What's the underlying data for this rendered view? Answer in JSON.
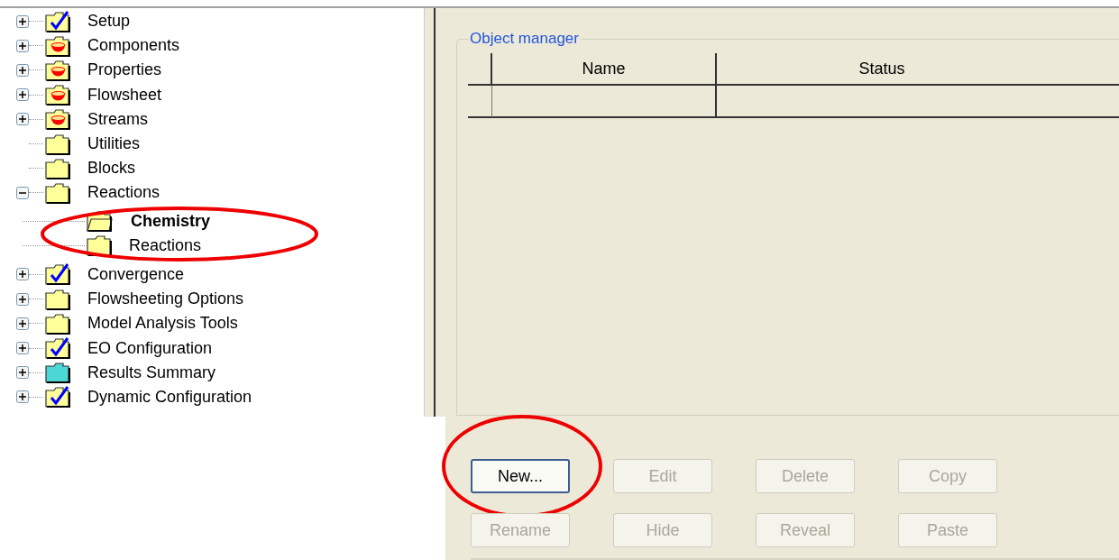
{
  "tree": [
    {
      "label": "Setup",
      "kind": "check",
      "expanded": false,
      "selected": false
    },
    {
      "label": "Components",
      "kind": "pot",
      "expanded": false,
      "selected": false
    },
    {
      "label": "Properties",
      "kind": "pot",
      "expanded": false,
      "selected": false
    },
    {
      "label": "Flowsheet",
      "kind": "pot",
      "expanded": false,
      "selected": false
    },
    {
      "label": "Streams",
      "kind": "pot",
      "expanded": false,
      "selected": false
    },
    {
      "label": "Utilities",
      "kind": "folder",
      "selected": false
    },
    {
      "label": "Blocks",
      "kind": "folder",
      "selected": false
    },
    {
      "label": "Reactions",
      "kind": "folder",
      "expanded": true,
      "selected": false,
      "children_circled": true,
      "children": [
        {
          "label": "Chemistry",
          "kind": "open",
          "selected": true
        },
        {
          "label": "Reactions",
          "kind": "folder",
          "selected": false
        }
      ]
    },
    {
      "label": "Convergence",
      "kind": "check",
      "expanded": false,
      "selected": false
    },
    {
      "label": "Flowsheeting Options",
      "kind": "folder",
      "expanded": false,
      "selected": false
    },
    {
      "label": "Model Analysis Tools",
      "kind": "folder",
      "expanded": false,
      "selected": false
    },
    {
      "label": "EO Configuration",
      "kind": "check",
      "expanded": false,
      "selected": false
    },
    {
      "label": "Results Summary",
      "kind": "cyan",
      "expanded": false,
      "selected": false
    },
    {
      "label": "Dynamic Configuration",
      "kind": "check",
      "expanded": false,
      "selected": false
    }
  ],
  "object_manager": {
    "title": "Object manager",
    "columns": [
      "Name",
      "Status"
    ],
    "buttons": [
      {
        "label": "New...",
        "disabled": false,
        "circled": true
      },
      {
        "label": "Edit",
        "disabled": true,
        "circled": false
      },
      {
        "label": "Delete",
        "disabled": true,
        "circled": false
      },
      {
        "label": "Copy",
        "disabled": true,
        "circled": false
      },
      {
        "label": "Rename",
        "disabled": true,
        "circled": false
      },
      {
        "label": "Hide",
        "disabled": true,
        "circled": false
      },
      {
        "label": "Reveal",
        "disabled": true,
        "circled": false
      },
      {
        "label": "Paste",
        "disabled": true,
        "circled": false
      }
    ]
  }
}
